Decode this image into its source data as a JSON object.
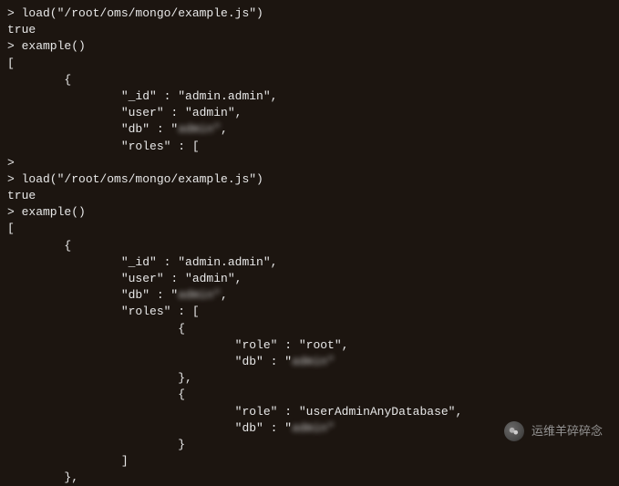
{
  "block1": {
    "cmd1": "> load(\"/root/oms/mongo/example.js\")",
    "result1": "true",
    "cmd2": "> example()",
    "bracket_open": "[",
    "obj_open": "        {",
    "id_line": "                \"_id\" : \"admin.admin\",",
    "user_line": "                \"user\" : \"admin\",",
    "db_prefix": "                \"db\" : \"",
    "db_blur": "admin\"",
    "db_suffix": ",",
    "roles_line": "                \"roles\" : ["
  },
  "divider": ">",
  "block2": {
    "cmd1": "> load(\"/root/oms/mongo/example.js\")",
    "result1": "true",
    "cmd2": "> example()",
    "bracket_open": "[",
    "obj_open": "        {",
    "id_line": "                \"_id\" : \"admin.admin\",",
    "user_line": "                \"user\" : \"admin\",",
    "db_prefix": "                \"db\" : \"",
    "db_blur": "admin\"",
    "db_suffix": ",",
    "roles_open": "                \"roles\" : [",
    "r1_open": "                        {",
    "r1_role": "                                \"role\" : \"root\",",
    "r1_db_prefix": "                                \"db\" : \"",
    "r1_db_blur": "admin\"",
    "r1_close": "                        },",
    "r2_open": "                        {",
    "r2_role": "                                \"role\" : \"userAdminAnyDatabase\",",
    "r2_db_prefix": "                                \"db\" : \"",
    "r2_db_blur": "admin\"",
    "r2_close": "                        }",
    "roles_close": "                ]",
    "obj_close": "        },"
  },
  "watermark": {
    "text": "运维羊碎碎念"
  }
}
